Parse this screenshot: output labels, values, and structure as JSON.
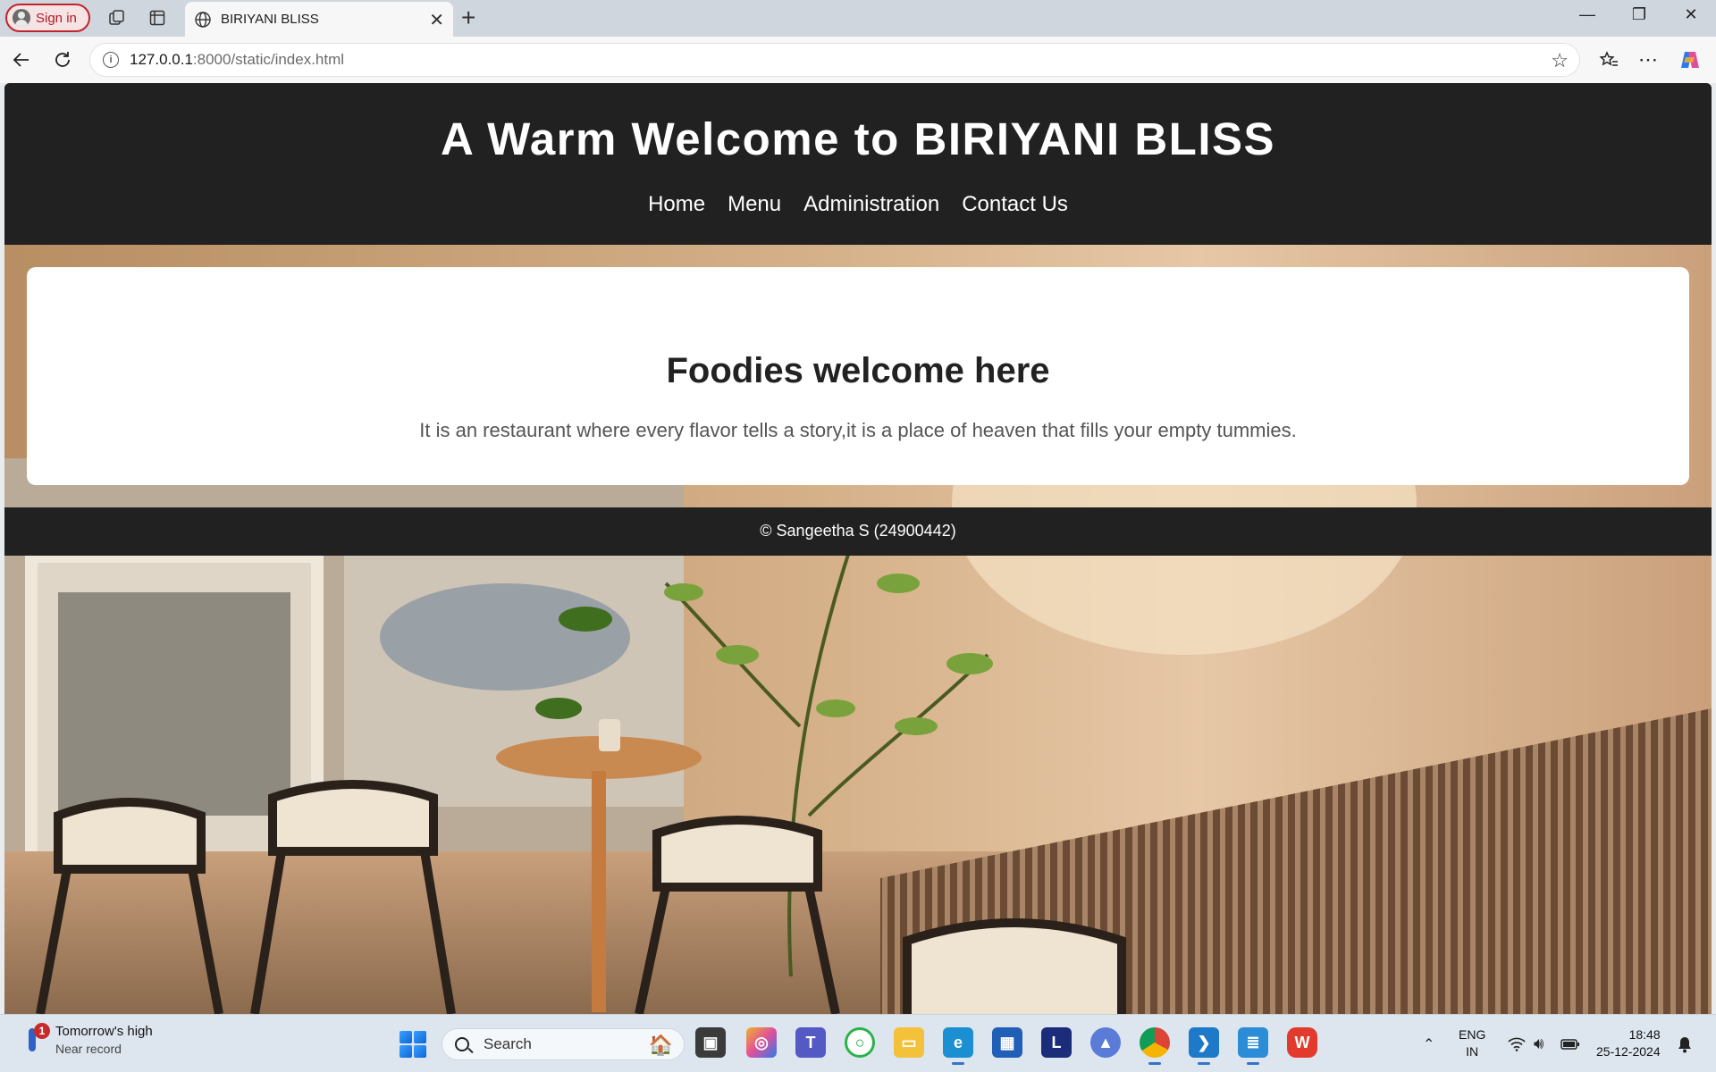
{
  "browser": {
    "signin_label": "Sign in",
    "tab_title": "BIRIYANI BLISS",
    "url_host": "127.0.0.1",
    "url_rest": ":8000/static/index.html"
  },
  "site": {
    "heading": "A Warm Welcome to BIRIYANI BLISS",
    "nav": [
      "Home",
      "Menu",
      "Administration",
      "Contact Us"
    ],
    "card_title": "Foodies welcome here",
    "card_text": "It is an restaurant where every flavor tells a story,it is a place of heaven that fills your empty tummies.",
    "footer": "© Sangeetha S (24900442)"
  },
  "taskbar": {
    "weather_badge": "1",
    "weather_title": "Tomorrow's high",
    "weather_sub": "Near record",
    "search_placeholder": "Search",
    "lang_line1": "ENG",
    "lang_line2": "IN",
    "time": "18:48",
    "date": "25-12-2024"
  },
  "colors": {
    "header_bg": "#212121",
    "card_bg": "#ffffff",
    "signin_accent": "#c0242d"
  }
}
